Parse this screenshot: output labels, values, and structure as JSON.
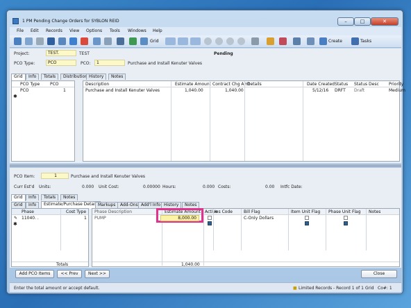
{
  "window": {
    "title": "1 PM Pending Change Orders for SYBLON REID",
    "controls": {
      "minimize": "–",
      "maximize": "□",
      "close": "✕"
    }
  },
  "menu": [
    "File",
    "Edit",
    "Records",
    "View",
    "Options",
    "Tools",
    "Windows",
    "Help"
  ],
  "toolbar": {
    "grid_label": "Grid",
    "create_label": "Create",
    "tasks_label": "Tasks"
  },
  "header": {
    "project_label": "Project:",
    "project_value": "TEST.",
    "project_desc": "TEST",
    "status": "Pending",
    "pco_type_label": "PCO Type:",
    "pco_type_value": "PCO",
    "pco_label": "PCO:",
    "pco_value": "1",
    "pco_desc": "Purchase and Install Kenuter Valves"
  },
  "top_tabs": [
    "Grid",
    "Info",
    "Totals",
    "Distribution",
    "History",
    "Notes"
  ],
  "top_grid": {
    "left_headers": [
      "PCO Type",
      "PCO"
    ],
    "left_row": [
      "PCO",
      "1"
    ],
    "headers": [
      "Description",
      "Estimate Amount",
      "Contract Chg Amt",
      "Details",
      "Date Created",
      "Status",
      "Status Desc",
      "Priority"
    ],
    "row": [
      "Purchase and Install Kenuter Valves",
      "1,040.00",
      "1,040.00",
      "",
      "5/12/16",
      "DRFT",
      "Draft",
      "Medium"
    ]
  },
  "item": {
    "pco_item_label": "PCO Item:",
    "pco_item_value": "1",
    "pco_item_desc": "Purchase and Install Kenuter Valves",
    "curr_estd_label": "Curr Est'd",
    "units_label": "Units:",
    "units_value": "0.000",
    "unit_cost_label": "Unit Cost:",
    "unit_cost_value": "0.00000",
    "hours_label": "Hours:",
    "hours_value": "0.000",
    "costs_label": "Costs:",
    "costs_value": "0.00",
    "intfc_label": "Intfc Date:"
  },
  "mid_tabs": [
    "Grid",
    "Info",
    "Totals",
    "Notes"
  ],
  "bottom_tabs": [
    "Grid",
    "Info",
    "Estimate/Purchase Details",
    "Markups",
    "Add-Ons",
    "Add'l Info",
    "History",
    "Notes"
  ],
  "bottom_grid": {
    "left_headers": [
      "Phase",
      "Cost Type"
    ],
    "left_row": [
      "11040.  .",
      "1"
    ],
    "totals_label": "Totals",
    "headers": [
      "Phase Description",
      "Estimate Amount",
      "Active",
      "Ins Code",
      "Bill Flag",
      "Item Unit Flag",
      "Phase Unit Flag",
      "Notes"
    ],
    "row": [
      "PUMP",
      "8,000.00",
      "",
      "",
      "C-Only Dollars",
      "",
      "",
      ""
    ],
    "total_value": "1,040.00"
  },
  "buttons": {
    "add": "Add PCO Items",
    "prev": "<< Prev",
    "next": "Next >>",
    "close": "Close"
  },
  "status": {
    "message": "Enter the total amount or accept default.",
    "records": "Limited Records - Record 1 of 1",
    "view": "Grid",
    "co": "Co#: 1"
  },
  "colors": {
    "highlight": "#e0338e",
    "yellow_field": "#fdf8c8",
    "active_tab": "#ffffff"
  }
}
